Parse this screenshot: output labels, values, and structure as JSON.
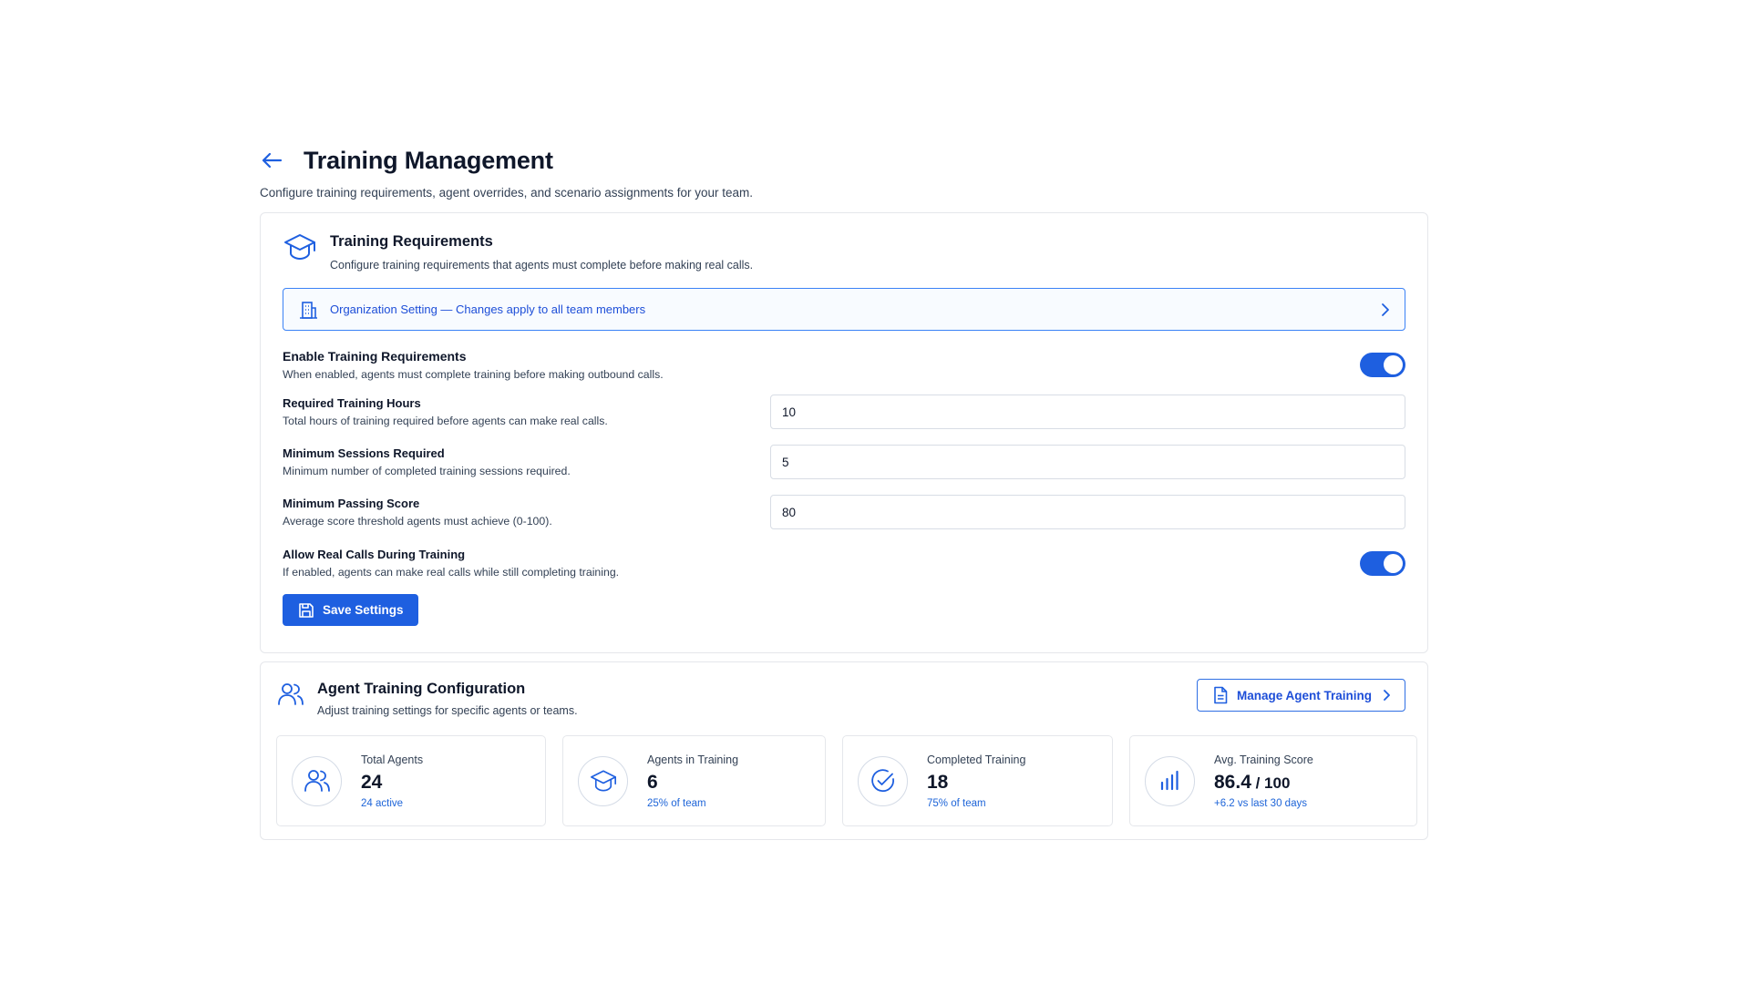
{
  "header": {
    "title": "Training Management",
    "subtitle": "Configure training requirements, agent overrides, and scenario assignments for your team."
  },
  "requirements": {
    "title": "Training Requirements",
    "description": "Configure training requirements that agents must complete before making real calls.",
    "banner": "Organization Setting — Changes apply to all team members",
    "enable": {
      "label": "Enable Training Requirements",
      "description": "When enabled, agents must complete training before making outbound calls.",
      "on": true
    },
    "hours": {
      "label": "Required Training Hours",
      "description": "Total hours of training required before agents can make real calls.",
      "value": "10"
    },
    "sessions": {
      "label": "Minimum Sessions Required",
      "description": "Minimum number of completed training sessions required.",
      "value": "5"
    },
    "score": {
      "label": "Minimum Passing Score",
      "description": "Average score threshold agents must achieve (0-100).",
      "value": "80"
    },
    "allow_calls": {
      "label": "Allow Real Calls During Training",
      "description": "If enabled, agents can make real calls while still completing training.",
      "on": true
    },
    "save_label": "Save Settings"
  },
  "agent_config": {
    "title": "Agent Training Configuration",
    "description": "Adjust training settings for specific agents or teams.",
    "manage_label": "Manage Agent Training",
    "stats": [
      {
        "label": "Total Agents",
        "value": "24",
        "suffix": "",
        "sub": "24 active",
        "icon": "users-icon"
      },
      {
        "label": "Agents in Training",
        "value": "6",
        "suffix": "",
        "sub": "25% of team",
        "icon": "graduation-cap-icon"
      },
      {
        "label": "Completed Training",
        "value": "18",
        "suffix": "",
        "sub": "75% of team",
        "icon": "check-circle-icon"
      },
      {
        "label": "Avg. Training Score",
        "value": "86.4",
        "suffix": " / 100",
        "sub": "+6.2 vs last 30 days",
        "icon": "bar-chart-icon"
      }
    ]
  },
  "colors": {
    "accent": "#1e5fe0",
    "accent_text": "#1d4ed8",
    "border": "#e5e7eb"
  }
}
